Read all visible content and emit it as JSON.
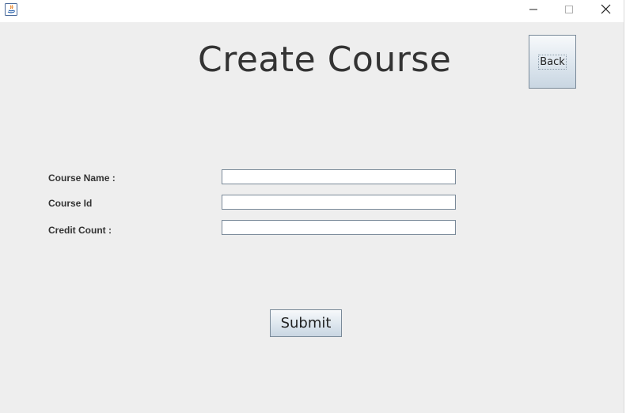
{
  "window": {
    "app_icon": "java-icon",
    "controls": {
      "minimize_icon": "minimize-icon",
      "maximize_icon": "maximize-icon",
      "close_icon": "close-icon"
    }
  },
  "page": {
    "title": "Create Course"
  },
  "toolbar": {
    "back_label": "Back"
  },
  "form": {
    "fields": [
      {
        "label": "Course Name :",
        "value": ""
      },
      {
        "label": "Course Id",
        "value": ""
      },
      {
        "label": "Credit Count :",
        "value": ""
      }
    ],
    "submit_label": "Submit"
  },
  "colors": {
    "background": "#eeeeee",
    "title_text": "#333333",
    "button_gradient_top": "#f7f9fb",
    "button_gradient_bottom": "#c9d6e2",
    "button_border": "#7a8a99"
  }
}
